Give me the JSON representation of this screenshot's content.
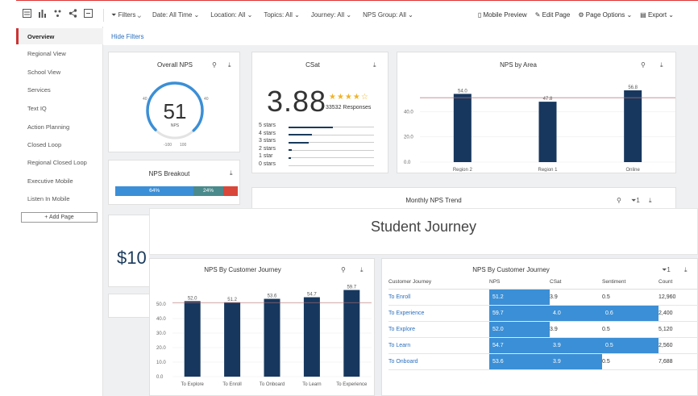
{
  "toolbar": {
    "icons": [
      "dashboard-icon",
      "bar-chart-icon",
      "hierarchy-icon",
      "share-icon",
      "layout-icon"
    ],
    "filters_label": "Filters",
    "date": "Date: All Time",
    "location": "Location: All",
    "topics": "Topics: All",
    "journey": "Journey: All",
    "nps_group": "NPS Group: All",
    "mobile_preview": "Mobile Preview",
    "edit_page": "Edit Page",
    "page_options": "Page Options",
    "export": "Export",
    "hide_filters": "Hide Filters"
  },
  "sidebar": {
    "items": [
      {
        "label": "Overview",
        "active": true
      },
      {
        "label": "Regional View"
      },
      {
        "label": "School View"
      },
      {
        "label": "Services"
      },
      {
        "label": "Text IQ"
      },
      {
        "label": "Action Planning"
      },
      {
        "label": "Closed Loop"
      },
      {
        "label": "Regional Closed Loop"
      },
      {
        "label": "Executive Mobile"
      },
      {
        "label": "Listen In Mobile"
      }
    ],
    "add_page": "+ Add Page"
  },
  "overall_nps": {
    "title": "Overall NPS",
    "value": "51",
    "unit": "NPS",
    "scale_min": "-100",
    "scale_max": "100",
    "mark_left": "40",
    "mark_right": "40",
    "gauge_fraction": 0.755,
    "accent": "#3b8fd6"
  },
  "nps_breakout": {
    "title": "NPS Breakout",
    "segments": [
      {
        "label": "64%",
        "value": 64,
        "color": "#3b8fd6"
      },
      {
        "label": "24%",
        "value": 24,
        "color": "#4a8a8c"
      },
      {
        "label": "",
        "value": 12,
        "color": "#d9473a"
      }
    ]
  },
  "csat": {
    "title": "CSat",
    "value": "3.88",
    "stars": "★★★★☆",
    "responses": "33532 Responses",
    "rows": [
      {
        "label": "5 stars",
        "fraction": 0.52
      },
      {
        "label": "4 stars",
        "fraction": 0.27
      },
      {
        "label": "3 stars",
        "fraction": 0.24
      },
      {
        "label": "2 stars",
        "fraction": 0.04
      },
      {
        "label": "1 star",
        "fraction": 0.03
      },
      {
        "label": "0 stars",
        "fraction": 0.0
      }
    ]
  },
  "monthly_trend": {
    "title": "Monthly NPS Trend",
    "filter_count": "1"
  },
  "big_value": {
    "value": "$10"
  },
  "student_journey": {
    "title": "Student Journey"
  },
  "journey_table": {
    "title": "NPS By Customer Journey",
    "filter_count": "1",
    "headers": [
      "Customer Journey",
      "NPS",
      "CSat",
      "Sentiment",
      "Count"
    ],
    "rows": [
      {
        "step": "To Enroll",
        "nps": "51.2",
        "csat": "3.9",
        "sentiment": "0.5",
        "count": "12,960",
        "hl": [
          true,
          false,
          false
        ]
      },
      {
        "step": "To Experience",
        "nps": "59.7",
        "csat": "4.0",
        "sentiment": "0.6",
        "count": "2,400",
        "hl": [
          true,
          true,
          true
        ]
      },
      {
        "step": "To Explore",
        "nps": "52.0",
        "csat": "3.9",
        "sentiment": "0.5",
        "count": "5,120",
        "hl": [
          true,
          false,
          false
        ]
      },
      {
        "step": "To Learn",
        "nps": "54.7",
        "csat": "3.9",
        "sentiment": "0.5",
        "count": "2,560",
        "hl": [
          true,
          true,
          true
        ]
      },
      {
        "step": "To Onboard",
        "nps": "53.6",
        "csat": "3.9",
        "sentiment": "0.5",
        "count": "7,688",
        "hl": [
          true,
          true,
          false
        ]
      }
    ]
  },
  "chart_data": [
    {
      "type": "bar",
      "title": "NPS by Area",
      "categories": [
        "Region 2",
        "Region 1",
        "Online"
      ],
      "values": [
        54.0,
        47.8,
        56.8
      ],
      "yticks": [
        "0.0",
        "20.0",
        "40.0"
      ],
      "ylim": [
        0,
        60
      ],
      "reference_line": 51,
      "color": "#17375e"
    },
    {
      "type": "bar",
      "title": "NPS By Customer Journey",
      "categories": [
        "To Explore",
        "To Enroll",
        "To Onboard",
        "To Learn",
        "To Experience"
      ],
      "values": [
        52.0,
        51.2,
        53.6,
        54.7,
        59.7
      ],
      "yticks": [
        "0.0",
        "10.0",
        "20.0",
        "30.0",
        "40.0",
        "50.0"
      ],
      "ylim": [
        0,
        60
      ],
      "reference_line": 51,
      "color": "#17375e"
    }
  ]
}
